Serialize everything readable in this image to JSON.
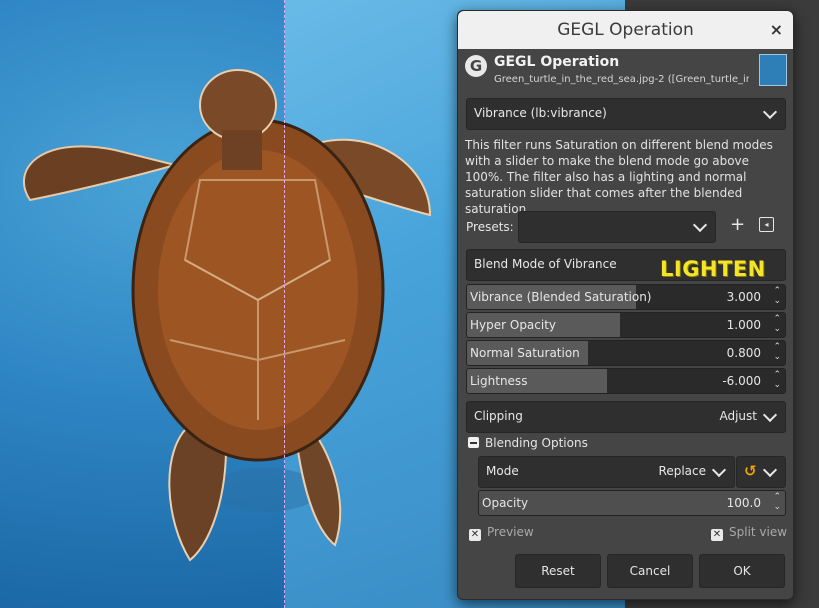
{
  "dialog": {
    "window_title": "GEGL Operation",
    "close_glyph": "×",
    "header_title": "GEGL Operation",
    "header_subtitle": "Green_turtle_in_the_red_sea.jpg-2 ([Green_turtle_in...",
    "logo_glyph": "G",
    "operation": "Vibrance (lb:vibrance)",
    "description": "This filter runs Saturation on different blend modes with a slider to make the blend mode go above 100%. The filter also has a lighting and normal saturation slider that comes after the blended saturation.",
    "presets_label": "Presets:",
    "presets_value": "",
    "blend_mode_label": "Blend Mode of Vibrance",
    "blend_mode_value": "LIGHTEN",
    "sliders": [
      {
        "name": "Vibrance (Blended Saturation)",
        "value": "3.000",
        "fill": 0.53
      },
      {
        "name": "Hyper Opacity",
        "value": "1.000",
        "fill": 0.48
      },
      {
        "name": "Normal Saturation",
        "value": "0.800",
        "fill": 0.38
      },
      {
        "name": "Lightness",
        "value": "-6.000",
        "fill": 0.44
      }
    ],
    "clipping_label": "Clipping",
    "clipping_value": "Adjust",
    "blending_section": "Blending Options",
    "mode_label": "Mode",
    "mode_value": "Replace",
    "opacity_label": "Opacity",
    "opacity_value": "100.0",
    "preview_label": "Preview",
    "split_view_label": "Split view",
    "buttons": {
      "reset": "Reset",
      "cancel": "Cancel",
      "ok": "OK"
    }
  },
  "colors": {
    "dialog_bg": "#454545",
    "accent_yellow": "#f5e52a",
    "split_guide": "#e4a7f0"
  },
  "icons": [
    "close-icon",
    "gegl-logo-icon",
    "chevron-down-icon",
    "add-icon",
    "save-preset-icon",
    "spin-arrows-icon",
    "reset-composite-icon",
    "collapse-icon",
    "checkbox-icon"
  ]
}
